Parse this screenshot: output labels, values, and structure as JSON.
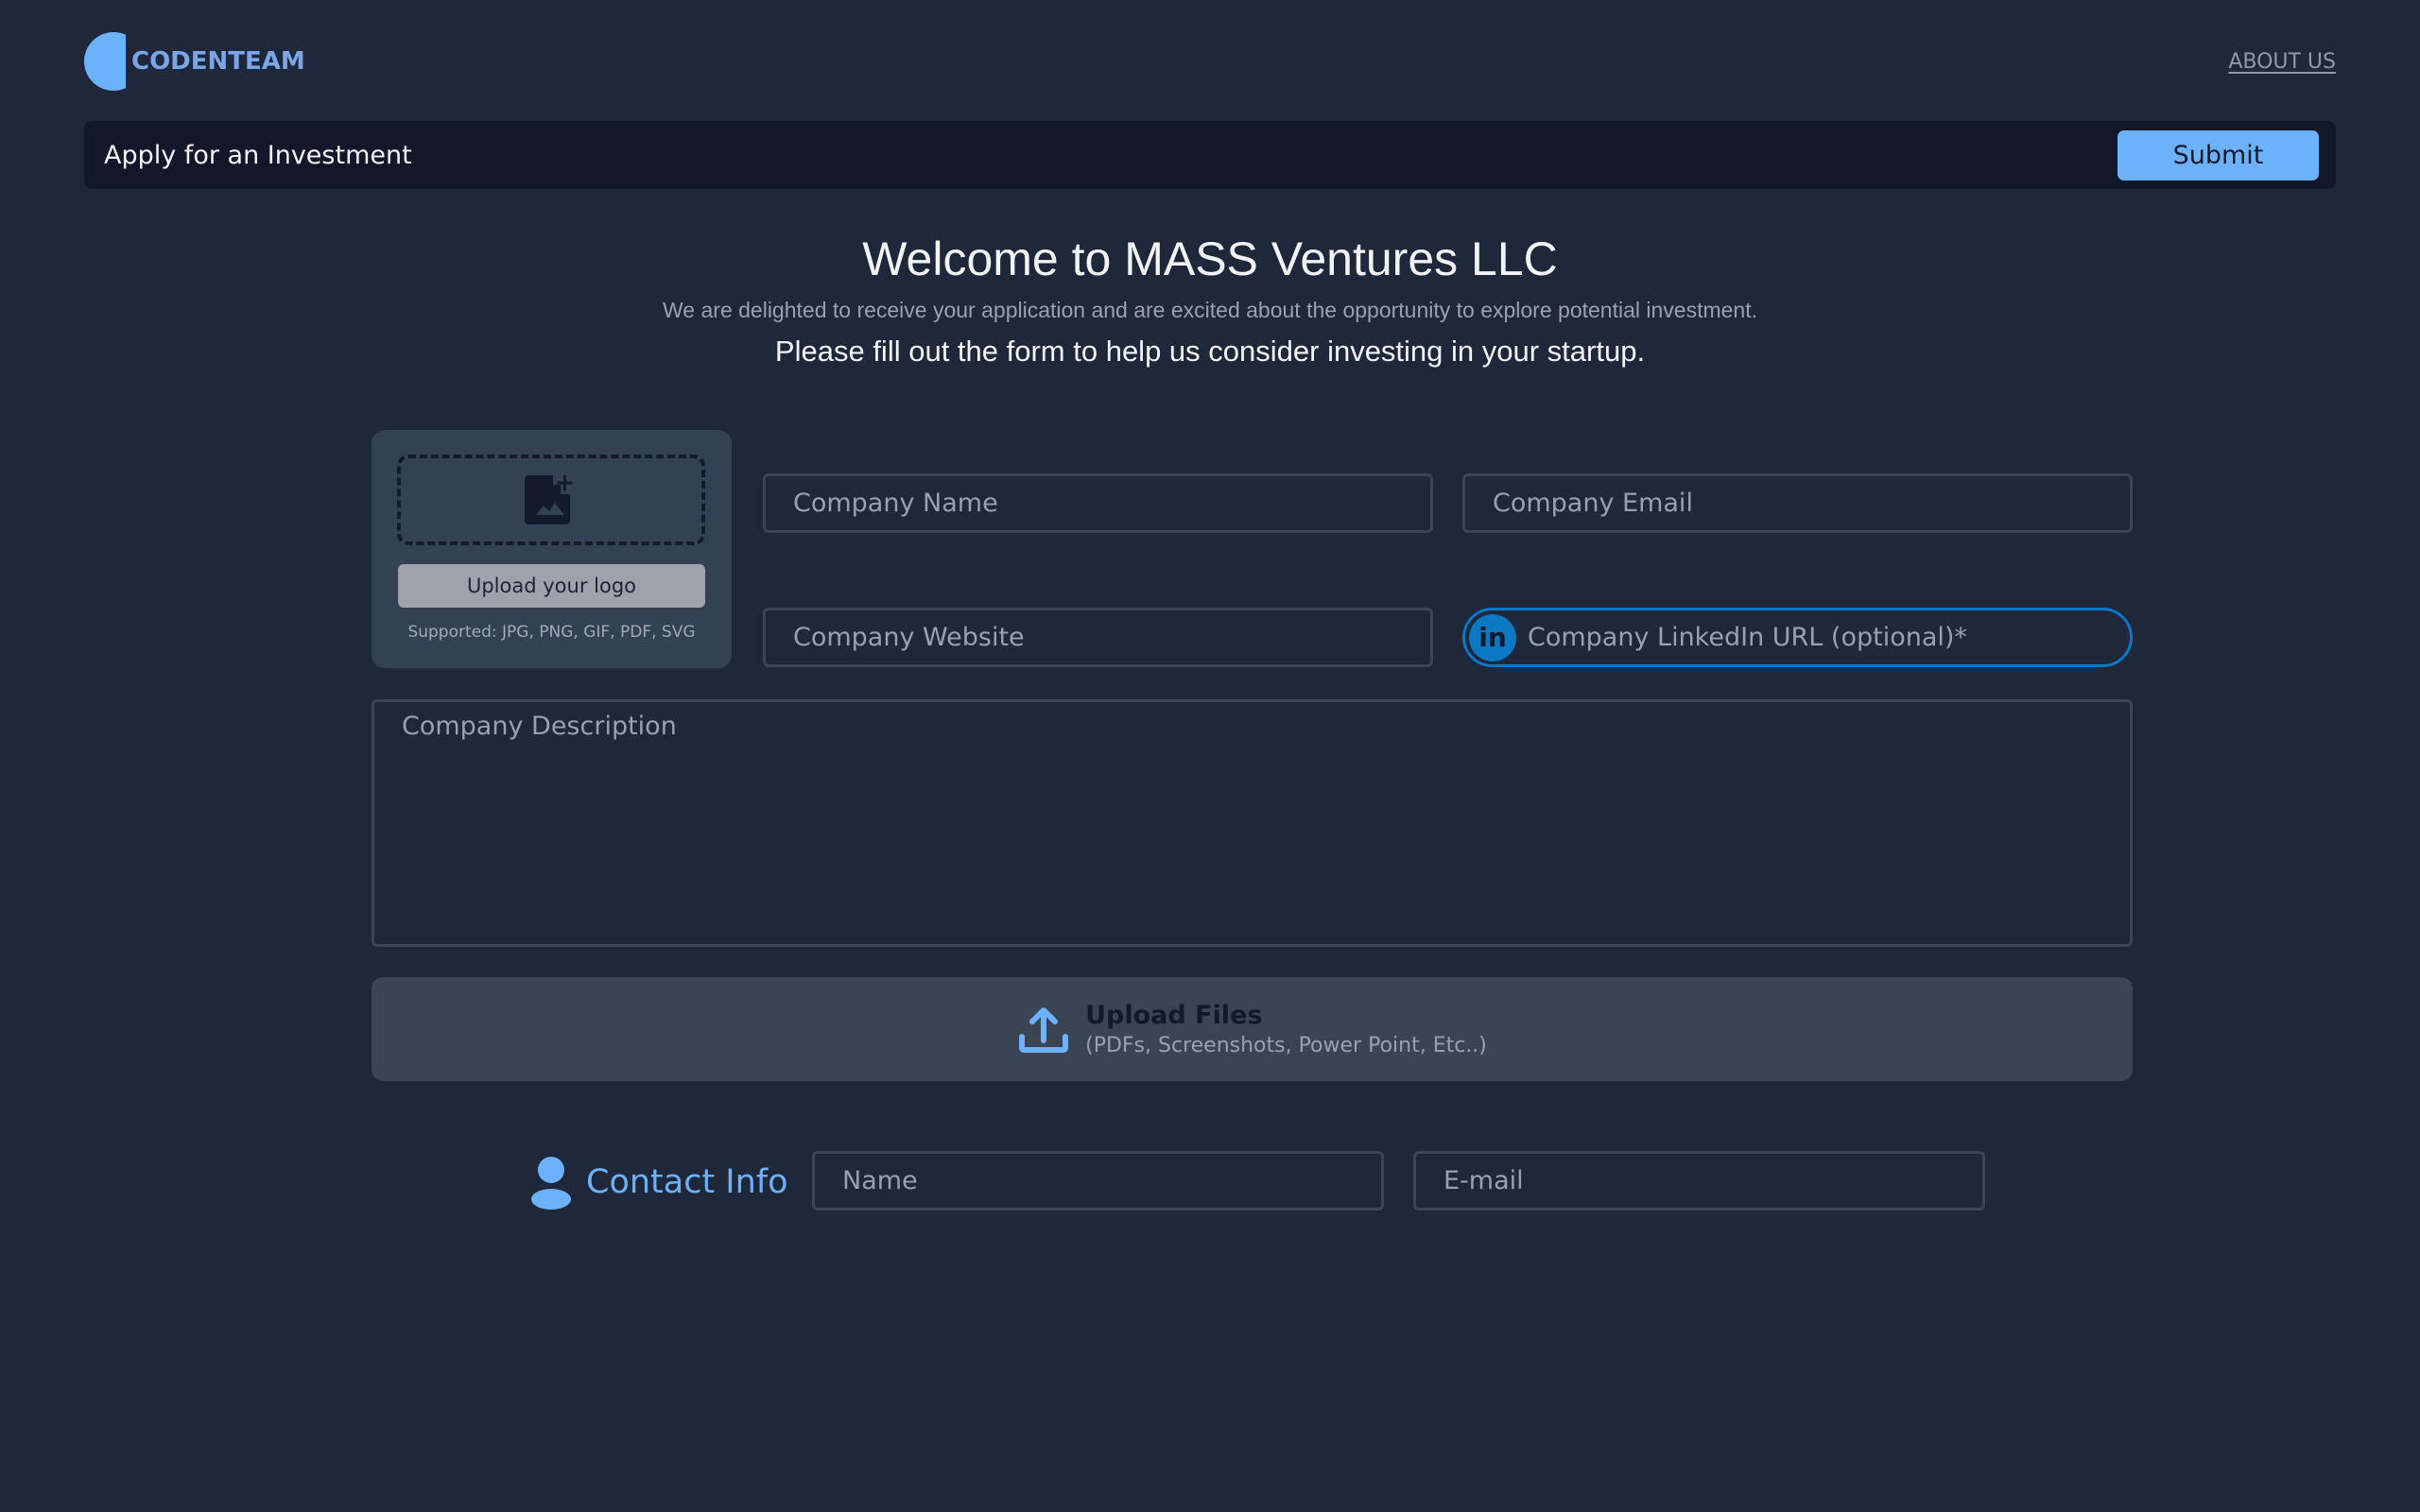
{
  "brand": {
    "name": "CODENTEAM",
    "logo_color": "#6cb2fb"
  },
  "nav": {
    "about_label": "ABOUT US"
  },
  "header": {
    "title": "Apply for an Investment",
    "submit_label": "Submit"
  },
  "intro": {
    "title": "Welcome to MASS Ventures LLC",
    "subtitle": "We are delighted to receive your application and are excited about the opportunity to explore potential investment.",
    "cta": "Please fill out the form to help us consider investing in your startup."
  },
  "logo_upload": {
    "icon": "add-photo-icon",
    "button_label": "Upload your logo",
    "supported": "Supported: JPG, PNG, GIF, PDF, SVG"
  },
  "company": {
    "name_placeholder": "Company Name",
    "email_placeholder": "Company Email",
    "website_placeholder": "Company Website",
    "linkedin_placeholder": "Company LinkedIn URL (optional)*",
    "linkedin_icon_text": "in",
    "description_placeholder": "Company Description"
  },
  "file_upload": {
    "icon": "upload-icon",
    "title": "Upload Files",
    "subtitle": "(PDFs, Screenshots, Power Point, Etc..)"
  },
  "contact": {
    "title": "Contact Info",
    "icon": "person-icon",
    "name_placeholder": "Name",
    "email_placeholder": "E-mail"
  },
  "colors": {
    "background": "#1f283a",
    "accent": "#6cb2fb",
    "linkedin": "#0a78c2",
    "header_bar": "#121829"
  }
}
